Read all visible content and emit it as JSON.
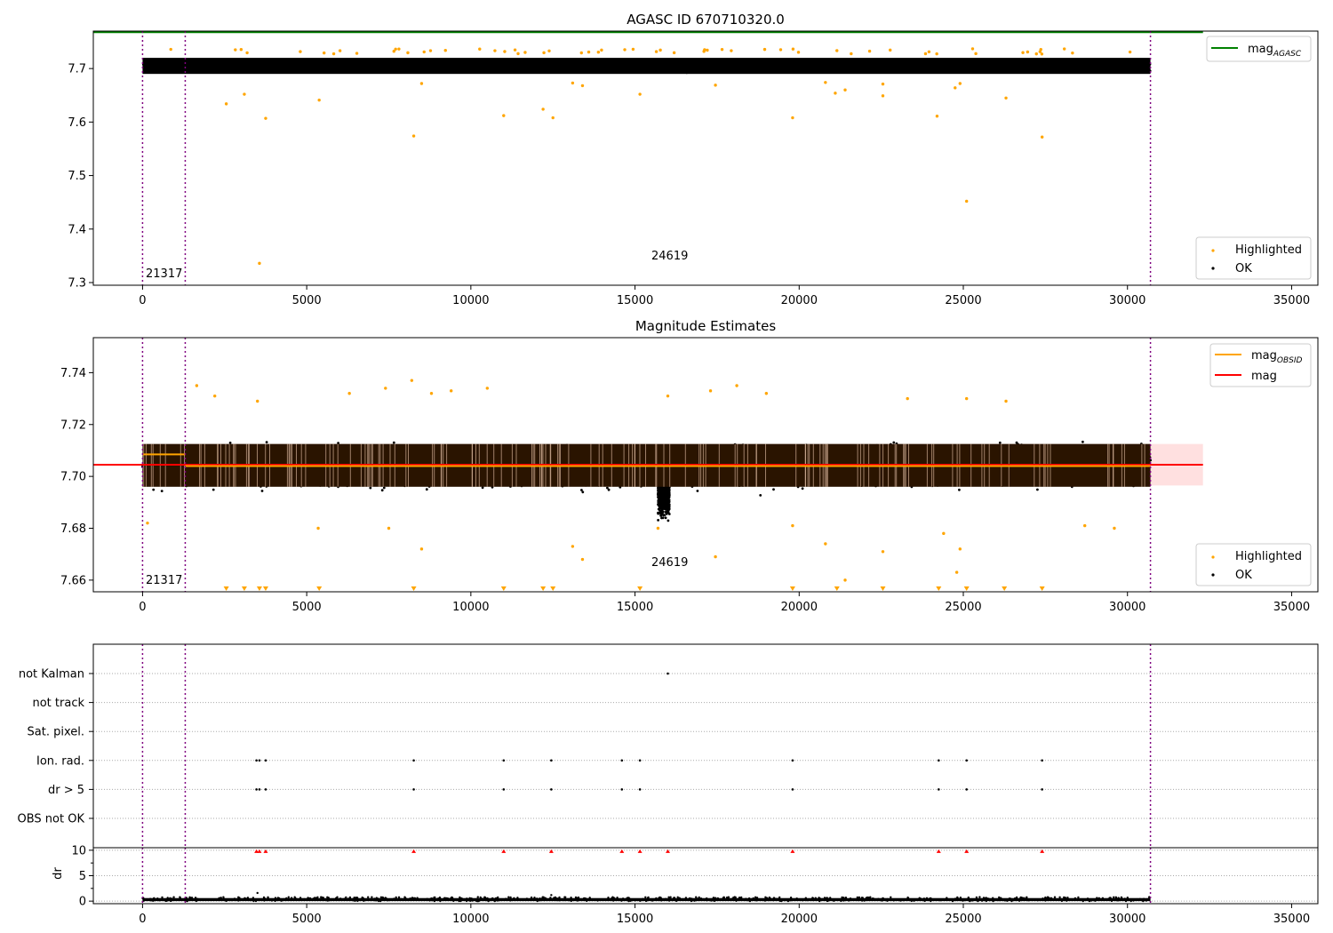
{
  "figure": {
    "panels": [
      {
        "id": "agasc",
        "title": "AGASC ID 670710320.0",
        "ylim": [
          7.295,
          7.77
        ],
        "yticks": [
          7.3,
          7.4,
          7.5,
          7.6,
          7.7
        ],
        "ytick_labels": [
          "7.3",
          "7.4",
          "7.5",
          "7.6",
          "7.7"
        ],
        "legend_line": {
          "label": "mag",
          "sub": "AGASC",
          "color": "#008000"
        },
        "legend_points": [
          {
            "label": "Highlighted",
            "color": "#ffa500"
          },
          {
            "label": "OK",
            "color": "#000000"
          }
        ]
      },
      {
        "id": "estimates",
        "title": "Magnitude Estimates",
        "ylim": [
          7.6555,
          7.7535
        ],
        "yticks": [
          7.66,
          7.68,
          7.7,
          7.72,
          7.74
        ],
        "ytick_labels": [
          "7.66",
          "7.68",
          "7.70",
          "7.72",
          "7.74"
        ],
        "legend_lines": [
          {
            "label": "mag",
            "sub": "OBSID",
            "color": "#ffa500"
          },
          {
            "label": "mag",
            "sub": "",
            "color": "#ff0000"
          }
        ],
        "legend_points": [
          {
            "label": "Highlighted",
            "color": "#ffa500"
          },
          {
            "label": "OK",
            "color": "#000000"
          }
        ]
      }
    ],
    "flags_panel": {
      "categories": [
        "not Kalman",
        "not track",
        "Sat. pixel.",
        "Ion. rad.",
        "dr > 5",
        "OBS not OK"
      ]
    },
    "dr_panel": {
      "ylabel": "dr",
      "yticks": [
        0,
        5,
        10
      ],
      "ytick_labels": [
        "0",
        "5",
        "10"
      ]
    },
    "xlim": [
      -1500,
      35800
    ],
    "xticks": [
      0,
      5000,
      10000,
      15000,
      20000,
      25000,
      30000,
      35000
    ],
    "xtick_labels": [
      "0",
      "5000",
      "10000",
      "15000",
      "20000",
      "25000",
      "30000",
      "35000"
    ],
    "obsids": [
      {
        "label": "21317",
        "x_text": 0
      },
      {
        "label": "24619",
        "x_text": 15400
      }
    ]
  },
  "chart_data": [
    {
      "type": "scatter",
      "title": "AGASC ID 670710320.0",
      "xlim": [
        -1500,
        35800
      ],
      "ylim": [
        7.295,
        7.77
      ],
      "grid": false,
      "legend": [
        "upper right",
        "lower right"
      ],
      "mag_agasc": 7.768,
      "obsid_boundaries": [
        0,
        1300,
        30700
      ],
      "ok_band": {
        "x": [
          0,
          30700
        ],
        "y_range": [
          7.683,
          7.727
        ]
      },
      "highlighted": [
        {
          "x": 2550,
          "y": 7.634
        },
        {
          "x": 3100,
          "y": 7.652
        },
        {
          "x": 3560,
          "y": 7.336
        },
        {
          "x": 3750,
          "y": 7.607
        },
        {
          "x": 5380,
          "y": 7.641
        },
        {
          "x": 8260,
          "y": 7.574
        },
        {
          "x": 8500,
          "y": 7.672
        },
        {
          "x": 11000,
          "y": 7.612
        },
        {
          "x": 12200,
          "y": 7.624
        },
        {
          "x": 12500,
          "y": 7.608
        },
        {
          "x": 13100,
          "y": 7.673
        },
        {
          "x": 13400,
          "y": 7.668
        },
        {
          "x": 15150,
          "y": 7.652
        },
        {
          "x": 17450,
          "y": 7.669
        },
        {
          "x": 19800,
          "y": 7.608
        },
        {
          "x": 20800,
          "y": 7.674
        },
        {
          "x": 21100,
          "y": 7.654
        },
        {
          "x": 21400,
          "y": 7.66
        },
        {
          "x": 22550,
          "y": 7.671
        },
        {
          "x": 22550,
          "y": 7.649
        },
        {
          "x": 24200,
          "y": 7.611
        },
        {
          "x": 24750,
          "y": 7.664
        },
        {
          "x": 24900,
          "y": 7.672
        },
        {
          "x": 25100,
          "y": 7.452
        },
        {
          "x": 26300,
          "y": 7.645
        },
        {
          "x": 27400,
          "y": 7.572
        }
      ]
    },
    {
      "type": "scatter",
      "title": "Magnitude Estimates",
      "xlim": [
        -1500,
        35800
      ],
      "ylim": [
        7.6555,
        7.7535
      ],
      "grid": false,
      "legend": [
        "upper right",
        "lower right"
      ],
      "mag": 7.7045,
      "mag_band": [
        7.6965,
        7.7125
      ],
      "mag_obsid": [
        {
          "x": [
            0,
            1300
          ],
          "y": 7.7085
        },
        {
          "x": [
            1300,
            30700
          ],
          "y": 7.704
        }
      ],
      "ok_band": {
        "x": [
          0,
          30700
        ],
        "y_range": [
          7.683,
          7.727
        ]
      },
      "dense_band": {
        "x": [
          0,
          30700
        ],
        "y_range": [
          7.696,
          7.7125
        ]
      },
      "highlighted": [
        {
          "x": 150,
          "y": 7.682
        },
        {
          "x": 1650,
          "y": 7.735
        },
        {
          "x": 2200,
          "y": 7.731
        },
        {
          "x": 3500,
          "y": 7.729
        },
        {
          "x": 5350,
          "y": 7.68
        },
        {
          "x": 6300,
          "y": 7.732
        },
        {
          "x": 7400,
          "y": 7.734
        },
        {
          "x": 7500,
          "y": 7.68
        },
        {
          "x": 8200,
          "y": 7.737
        },
        {
          "x": 8500,
          "y": 7.672
        },
        {
          "x": 8800,
          "y": 7.732
        },
        {
          "x": 9400,
          "y": 7.733
        },
        {
          "x": 10500,
          "y": 7.734
        },
        {
          "x": 13100,
          "y": 7.673
        },
        {
          "x": 13400,
          "y": 7.668
        },
        {
          "x": 15700,
          "y": 7.68
        },
        {
          "x": 16000,
          "y": 7.731
        },
        {
          "x": 17300,
          "y": 7.733
        },
        {
          "x": 17450,
          "y": 7.669
        },
        {
          "x": 18100,
          "y": 7.735
        },
        {
          "x": 19000,
          "y": 7.732
        },
        {
          "x": 19800,
          "y": 7.681
        },
        {
          "x": 20800,
          "y": 7.674
        },
        {
          "x": 21400,
          "y": 7.66
        },
        {
          "x": 22550,
          "y": 7.671
        },
        {
          "x": 23300,
          "y": 7.73
        },
        {
          "x": 24400,
          "y": 7.678
        },
        {
          "x": 24800,
          "y": 7.663
        },
        {
          "x": 24900,
          "y": 7.672
        },
        {
          "x": 25100,
          "y": 7.73
        },
        {
          "x": 26300,
          "y": 7.729
        },
        {
          "x": 28700,
          "y": 7.681
        },
        {
          "x": 29600,
          "y": 7.68
        }
      ],
      "below_range_markers": [
        2550,
        3100,
        3560,
        3750,
        5380,
        8260,
        11000,
        12200,
        12500,
        15150,
        19800,
        21150,
        22550,
        24250,
        25100,
        26250,
        27400
      ]
    },
    {
      "type": "scatter",
      "ylabel": "dr",
      "xlim": [
        -1500,
        35800
      ],
      "ylim": [
        -0.5,
        10.5
      ],
      "categories": [
        "not Kalman",
        "not track",
        "Sat. pixel.",
        "Ion. rad.",
        "dr > 5",
        "OBS not OK"
      ],
      "flags": [
        {
          "category": "not Kalman",
          "x": [
            16000
          ]
        },
        {
          "category": "Ion. rad.",
          "x": [
            3470,
            3560,
            3750,
            8260,
            11000,
            12450,
            14600,
            15150,
            19800,
            24250,
            25100,
            27400
          ]
        },
        {
          "category": "dr > 5",
          "x": [
            3470,
            3560,
            3750,
            8260,
            11000,
            12450,
            14600,
            15150,
            19800,
            24250,
            25100,
            27400
          ]
        }
      ],
      "dr_clipped_markers": [
        3470,
        3560,
        3750,
        8260,
        11000,
        12450,
        14600,
        15150,
        16000,
        19800,
        24250,
        25100,
        27400
      ],
      "dr_outliers": [
        {
          "x": 3500,
          "y": 1.6
        },
        {
          "x": 12450,
          "y": 1.2
        }
      ],
      "dr_typical_range": [
        0,
        0.6
      ]
    }
  ]
}
